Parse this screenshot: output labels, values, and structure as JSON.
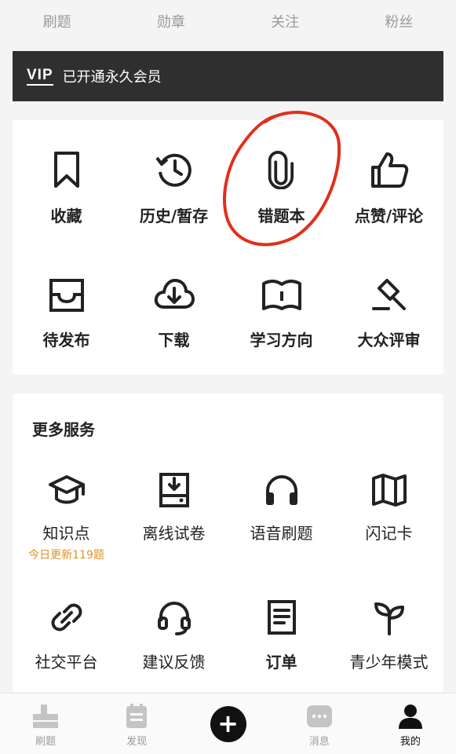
{
  "stats": [
    "刷题",
    "勋章",
    "关注",
    "粉丝"
  ],
  "vip": {
    "badge": "VIP",
    "label": "已开通永久会员"
  },
  "quick_actions": [
    {
      "label": "收藏",
      "icon": "bookmark-icon"
    },
    {
      "label": "历史/暂存",
      "icon": "history-icon"
    },
    {
      "label": "错题本",
      "icon": "paperclip-icon"
    },
    {
      "label": "点赞/评论",
      "icon": "thumbs-up-icon"
    },
    {
      "label": "待发布",
      "icon": "inbox-icon"
    },
    {
      "label": "下载",
      "icon": "cloud-download-icon"
    },
    {
      "label": "学习方向",
      "icon": "open-book-icon"
    },
    {
      "label": "大众评审",
      "icon": "gavel-icon"
    }
  ],
  "more_services": {
    "title": "更多服务",
    "items": [
      {
        "label": "知识点",
        "sub": "今日更新119题",
        "icon": "graduation-cap-icon"
      },
      {
        "label": "离线试卷",
        "icon": "offline-paper-icon"
      },
      {
        "label": "语音刷题",
        "icon": "headphones-icon"
      },
      {
        "label": "闪记卡",
        "icon": "map-icon"
      },
      {
        "label": "社交平台",
        "icon": "link-icon"
      },
      {
        "label": "建议反馈",
        "icon": "headset-icon"
      },
      {
        "label": "订单",
        "icon": "order-document-icon"
      },
      {
        "label": "青少年模式",
        "icon": "sprout-icon"
      }
    ]
  },
  "tabbar": [
    {
      "label": "刷题",
      "icon": "practice-icon"
    },
    {
      "label": "发现",
      "icon": "calendar-icon"
    },
    {
      "label": "",
      "icon": "plus-icon"
    },
    {
      "label": "消息",
      "icon": "message-icon"
    },
    {
      "label": "我的",
      "icon": "person-icon",
      "active": true
    }
  ],
  "colors": {
    "vip_bg": "#2f2f2f",
    "accent_orange": "#e0912a",
    "annotation_red": "#e0301e"
  }
}
